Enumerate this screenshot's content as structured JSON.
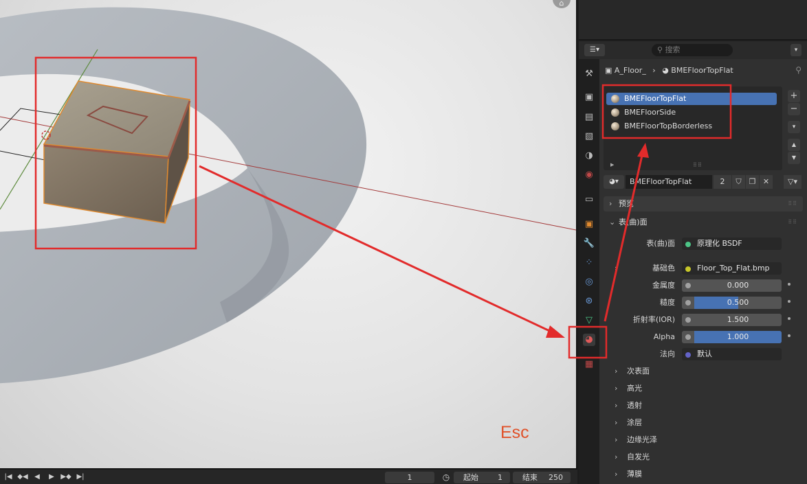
{
  "viewport": {
    "annotation": "Esc"
  },
  "timeline": {
    "current_frame": "1",
    "start_label": "起始",
    "start_value": "1",
    "end_label": "结束",
    "end_value": "250"
  },
  "header": {
    "search_placeholder": "搜索"
  },
  "breadcrumb": {
    "object": "A_Floor_",
    "material": "BMEFloorTopFlat"
  },
  "material_slots": [
    {
      "name": "BMEFloorTopFlat",
      "selected": true
    },
    {
      "name": "BMEFloorSide",
      "selected": false
    },
    {
      "name": "BMEFloorTopBorderless",
      "selected": false
    }
  ],
  "material": {
    "name": "BMEFloorTopFlat",
    "users": "2"
  },
  "sections": {
    "preview": "预览",
    "surface": "表(曲)面"
  },
  "surface": {
    "surface_label": "表(曲)面",
    "surface_value": "原理化 BSDF",
    "base_color_label": "基础色",
    "base_color_value": "Floor_Top_Flat.bmp",
    "metallic_label": "金属度",
    "metallic_value": "0.000",
    "metallic_fraction": 0,
    "roughness_label": "糙度",
    "roughness_value": "0.500",
    "roughness_fraction": 0.5,
    "ior_label": "折射率(IOR)",
    "ior_value": "1.500",
    "alpha_label": "Alpha",
    "alpha_value": "1.000",
    "alpha_fraction": 1,
    "normal_label": "法向",
    "normal_value": "默认"
  },
  "subpanels": [
    "次表面",
    "高光",
    "透射",
    "涂层",
    "边缘光泽",
    "自发光",
    "薄膜"
  ],
  "colors": {
    "accent": "#4772b3",
    "annotation": "#e22b2b"
  }
}
